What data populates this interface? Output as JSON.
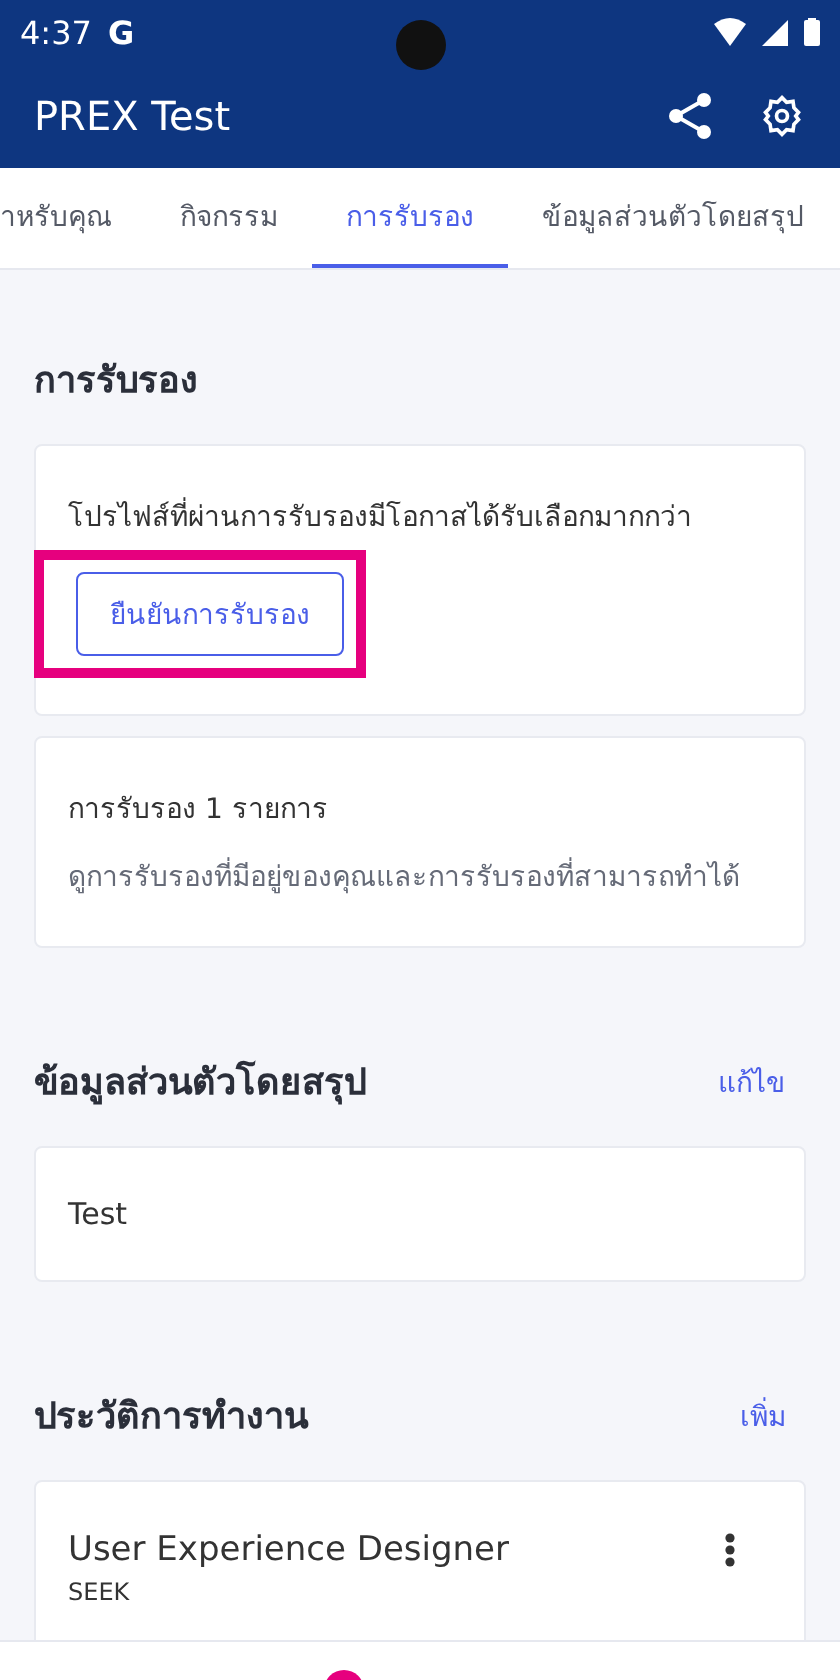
{
  "status_bar": {
    "time": "4:37",
    "app_letter": "G"
  },
  "app_bar": {
    "title": "PREX Test"
  },
  "tabs": [
    {
      "label": "าหรับคุณ",
      "selected": false
    },
    {
      "label": "กิจกรรม",
      "selected": false
    },
    {
      "label": "การรับรอง",
      "selected": true
    },
    {
      "label": "ข้อมูลส่วนตัวโดยสรุป",
      "selected": false
    }
  ],
  "endorsement": {
    "title": "การรับรอง",
    "prompt": "โปรไฟส์ที่ผ่านการรับรองมีโอกาสได้รับเลือกมากกว่า",
    "button": {
      "label": "ยืนยันการรับรอง",
      "highlighted": true
    },
    "count": "การรับรอง 1 รายการ",
    "description": "ดูการรับรองที่มีอยู่ของคุณและการรับรองที่สามารถทำได้"
  },
  "summary": {
    "title": "ข้อมูลส่วนตัวโดยสรุป",
    "action": "แก้ไข",
    "text": "Test"
  },
  "work_history": {
    "title": "ประวัติการทำงาน",
    "action": "เพิ่ม",
    "jobs": [
      {
        "role": "User Experience Designer",
        "company": "SEEK"
      }
    ]
  }
}
